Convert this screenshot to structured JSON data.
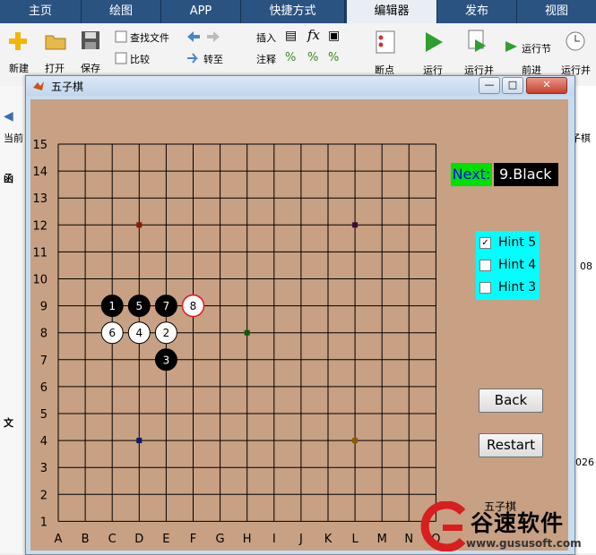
{
  "matlab": {
    "tabs": [
      "主页",
      "绘图",
      "APP",
      "快捷方式",
      "编辑器",
      "发布",
      "视图"
    ],
    "active_tab": "编辑器",
    "ribbon": {
      "new": "新建",
      "open": "打开",
      "save": "保存",
      "find_files": "查找文件",
      "compare": "比较",
      "goto": "转至",
      "insert": "插入",
      "comment": "注释",
      "breakpoints": "断点",
      "run": "运行",
      "run_advance": "运行并",
      "run_section": "运行节",
      "advance": "前进",
      "run_time": "运行并"
    },
    "left_labels": [
      "当前",
      "函",
      "文"
    ],
    "right_labels": [
      "子棋",
      "08",
      "026"
    ]
  },
  "window": {
    "title": "五子棋",
    "min_glyph": "—",
    "max_glyph": "□",
    "close_glyph": "✕"
  },
  "board": {
    "y_ticks": [
      "15",
      "14",
      "13",
      "12",
      "11",
      "10",
      "9",
      "8",
      "7",
      "6",
      "5",
      "4",
      "3",
      "2",
      "1"
    ],
    "x_ticks": [
      "A",
      "B",
      "C",
      "D",
      "E",
      "F",
      "G",
      "H",
      "I",
      "J",
      "K",
      "L",
      "M",
      "N",
      "O"
    ],
    "star_points": [
      {
        "col": "D",
        "row": 12,
        "color": "#8b1a00"
      },
      {
        "col": "L",
        "row": 12,
        "color": "#3a0a3a"
      },
      {
        "col": "H",
        "row": 8,
        "color": "#0a5a0a"
      },
      {
        "col": "D",
        "row": 4,
        "color": "#0a1a6a"
      },
      {
        "col": "L",
        "row": 4,
        "color": "#8a5a00"
      }
    ],
    "stones": [
      {
        "col": "C",
        "row": 9,
        "color": "black",
        "label": "1"
      },
      {
        "col": "E",
        "row": 8,
        "color": "white",
        "label": "2"
      },
      {
        "col": "E",
        "row": 7,
        "color": "black",
        "label": "3"
      },
      {
        "col": "D",
        "row": 8,
        "color": "white",
        "label": "4"
      },
      {
        "col": "D",
        "row": 9,
        "color": "black",
        "label": "5"
      },
      {
        "col": "C",
        "row": 8,
        "color": "white",
        "label": "6"
      },
      {
        "col": "E",
        "row": 9,
        "color": "black",
        "label": "7"
      },
      {
        "col": "F",
        "row": 9,
        "color": "white",
        "label": "8",
        "last_move": true
      }
    ]
  },
  "panel": {
    "next_label": "Next:",
    "next_value": "9.Black",
    "hints": [
      {
        "label": "Hint 5",
        "checked": true
      },
      {
        "label": "Hint 4",
        "checked": false
      },
      {
        "label": "Hint 3",
        "checked": false
      }
    ],
    "back_label": "Back",
    "restart_label": "Restart",
    "caption": "五子棋"
  },
  "watermark": {
    "text": "谷速软件",
    "url": "www.gususoft.com"
  }
}
